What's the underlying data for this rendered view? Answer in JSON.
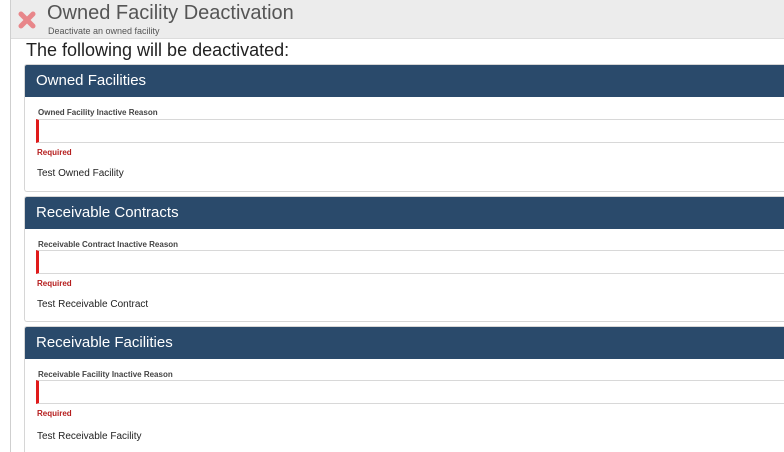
{
  "header": {
    "title": "Owned Facility Deactivation",
    "subtitle": "Deactivate an owned facility",
    "close_icon": "close-icon"
  },
  "main": {
    "heading": "The following will be deactivated:"
  },
  "sections": [
    {
      "title": "Owned Facilities",
      "field_label": "Owned Facility Inactive Reason",
      "field_value": "",
      "required_text": "Required",
      "item": "Test Owned Facility"
    },
    {
      "title": "Receivable Contracts",
      "field_label": "Receivable Contract Inactive Reason",
      "field_value": "",
      "required_text": "Required",
      "item": "Test Receivable Contract"
    },
    {
      "title": "Receivable Facilities",
      "field_label": "Receivable Facility Inactive Reason",
      "field_value": "",
      "required_text": "Required",
      "item": "Test Receivable Facility"
    }
  ],
  "colors": {
    "panel_header": "#2a4a6b",
    "required": "#b51d1d",
    "input_accent": "#e01a1a",
    "close_icon": "#e8868a"
  }
}
